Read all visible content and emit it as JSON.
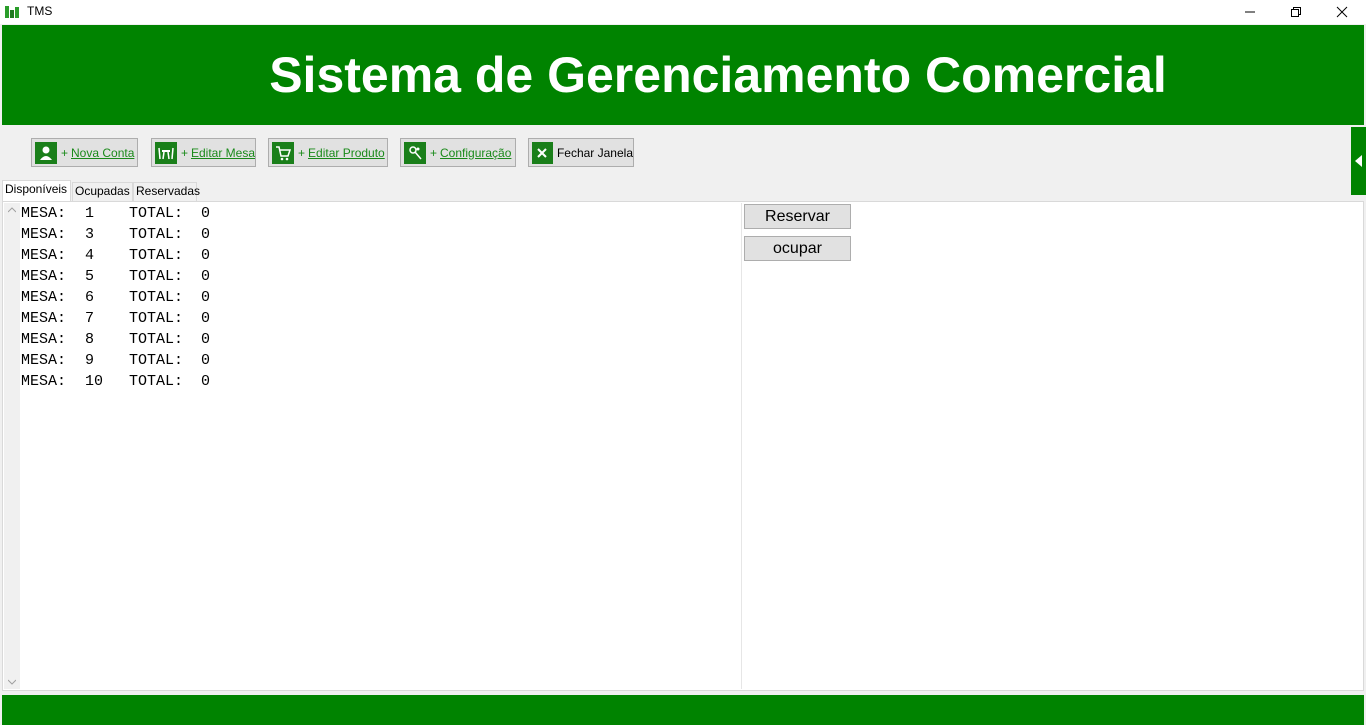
{
  "window": {
    "title": "TMS"
  },
  "header": {
    "title": "Sistema de Gerenciamento Comercial"
  },
  "toolbar": {
    "nova_conta": "Nova Conta",
    "editar_mesa": "Editar Mesa",
    "editar_produto": "Editar Produto",
    "configuracao": "Configuração",
    "fechar_janela": "Fechar Janela",
    "plus": "+"
  },
  "tabs": {
    "disponiveis": "Disponíveis",
    "ocupadas": "Ocupadas",
    "reservadas": "Reservadas"
  },
  "list": {
    "label_mesa": "MESA:",
    "label_total": "TOTAL:",
    "rows": [
      {
        "mesa": "1",
        "total": "0"
      },
      {
        "mesa": "3",
        "total": "0"
      },
      {
        "mesa": "4",
        "total": "0"
      },
      {
        "mesa": "5",
        "total": "0"
      },
      {
        "mesa": "6",
        "total": "0"
      },
      {
        "mesa": "7",
        "total": "0"
      },
      {
        "mesa": "8",
        "total": "0"
      },
      {
        "mesa": "9",
        "total": "0"
      },
      {
        "mesa": "10",
        "total": "0"
      }
    ]
  },
  "actions": {
    "reservar": "Reservar",
    "ocupar": "ocupar"
  },
  "colors": {
    "brand_green": "#008300"
  }
}
